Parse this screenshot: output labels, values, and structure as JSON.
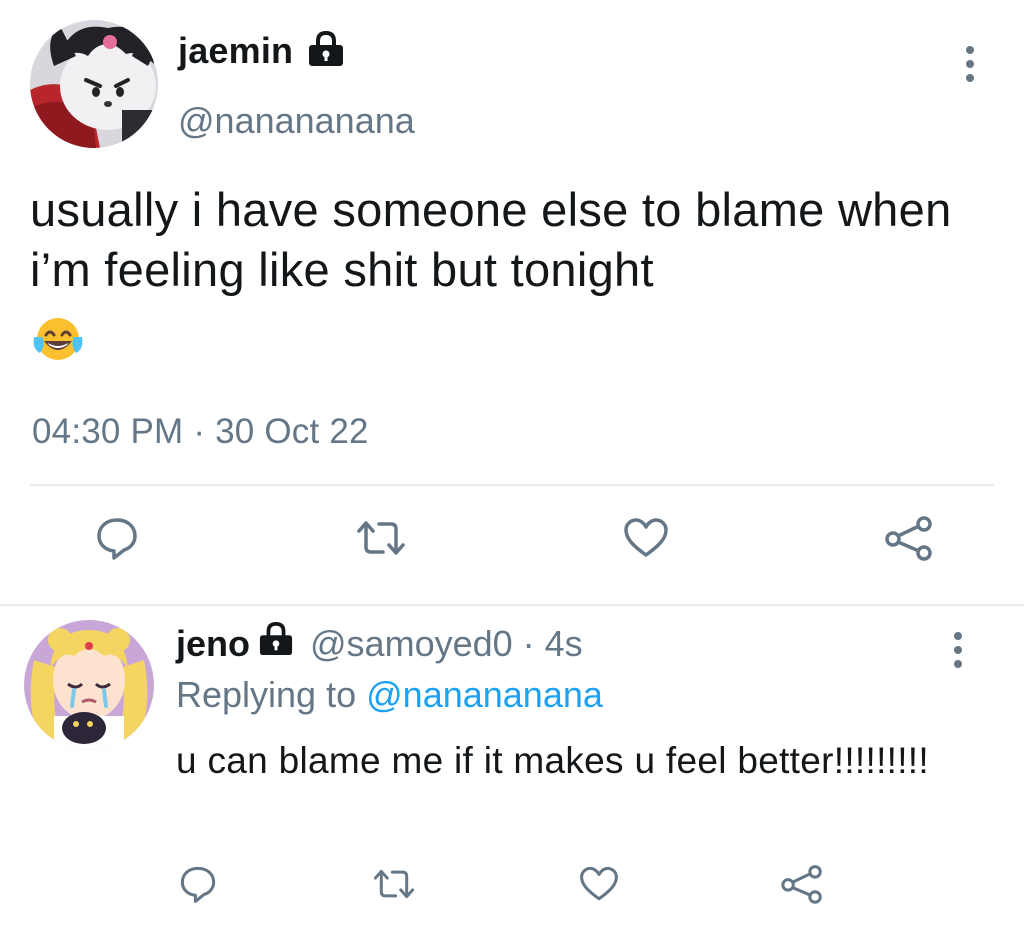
{
  "main_tweet": {
    "author_name": "jaemin",
    "handle": "@nanananana",
    "text": "usually i have someone else to blame when i’m feeling like shit but tonight",
    "emoji": "face-with-tears-of-joy",
    "timestamp": "04:30 PM · 30 Oct 22",
    "protected": true
  },
  "reply": {
    "author_name": "jeno",
    "handle": "@samoyed0",
    "separator": "·",
    "age": "4s",
    "replying_label": "Replying to",
    "replying_handle": "@nanananana",
    "text": "u can blame me if it makes u feel better!!!!!!!!!",
    "protected": true
  },
  "actions": [
    "reply",
    "retweet",
    "like",
    "share"
  ],
  "colors": {
    "text": "#14171a",
    "secondary": "#657786",
    "link": "#1da1f2",
    "icon": "#657786",
    "divider": "#e6ecf0"
  }
}
